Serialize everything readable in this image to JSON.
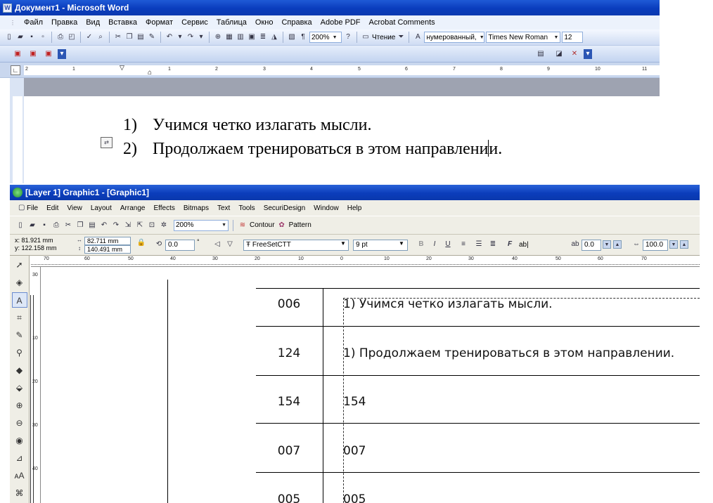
{
  "word": {
    "title": "Документ1 - Microsoft Word",
    "menu": [
      "Файл",
      "Правка",
      "Вид",
      "Вставка",
      "Формат",
      "Сервис",
      "Таблица",
      "Окно",
      "Справка",
      "Adobe PDF",
      "Acrobat Comments"
    ],
    "zoom": "200%",
    "read_label": "Чтение",
    "style_value": "нумерованный,",
    "font_value": "Times New Roman",
    "size_value": "12",
    "ruler_labels": [
      "2",
      "1",
      "1",
      "2",
      "3",
      "4",
      "5",
      "6",
      "7",
      "8",
      "9",
      "10",
      "11"
    ],
    "lines": [
      {
        "num": "1)",
        "text": "Учимся четко излагать мысли."
      },
      {
        "num": "2)",
        "text": "Продолжаем тренироваться в этом направлени",
        "tail": "и."
      }
    ]
  },
  "corel": {
    "title": "[Layer 1] Graphic1 - [Graphic1]",
    "menu": [
      "File",
      "Edit",
      "View",
      "Layout",
      "Arrange",
      "Effects",
      "Bitmaps",
      "Text",
      "Tools",
      "SecuriDesign",
      "Window",
      "Help"
    ],
    "zoom": "200%",
    "contour_label": "Contour",
    "pattern_label": "Pattern",
    "x_value": "x: 81.921 mm",
    "y_value": "y: 122.158 mm",
    "w_value": "82.711 mm",
    "h_value": "140.491 mm",
    "angle_value": "0.0",
    "font_value": "FreeSetCTT",
    "size_value": "9 pt",
    "kern_value": "0.0",
    "scale_value": "100.0",
    "ab_label": "ab|",
    "hruler_labels": [
      "70",
      "60",
      "50",
      "40",
      "30",
      "20",
      "10",
      "0",
      "10",
      "20",
      "30",
      "40",
      "50",
      "60",
      "70"
    ],
    "vruler_labels": [
      "30",
      "10",
      "20",
      "30",
      "40"
    ],
    "rows": [
      {
        "code": "006",
        "text": "1) Учимся четко излагать мысли."
      },
      {
        "code": "124",
        "text": "1) Продолжаем тренироваться в этом направлении."
      },
      {
        "code": "154",
        "text": "154"
      },
      {
        "code": "007",
        "text": "007"
      },
      {
        "code": "005",
        "text": "005"
      }
    ]
  }
}
